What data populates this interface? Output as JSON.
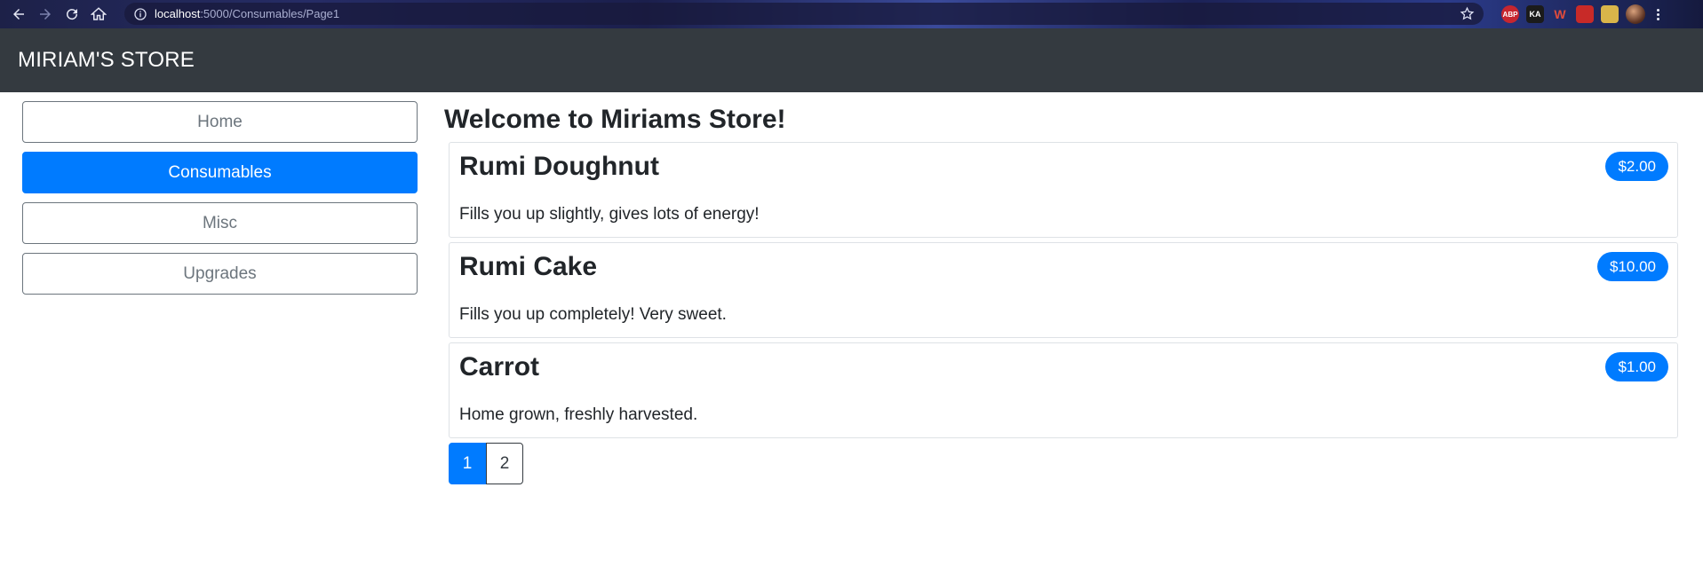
{
  "browser": {
    "url_host": "localhost",
    "url_path": ":5000/Consumables/Page1",
    "extensions": [
      "ABP",
      "KA",
      "W",
      "",
      ""
    ]
  },
  "site": {
    "brand": "MIRIAM'S STORE"
  },
  "sidebar": {
    "items": [
      {
        "label": "Home",
        "active": false
      },
      {
        "label": "Consumables",
        "active": true
      },
      {
        "label": "Misc",
        "active": false
      },
      {
        "label": "Upgrades",
        "active": false
      }
    ]
  },
  "main": {
    "heading": "Welcome to Miriams Store!",
    "products": [
      {
        "name": "Rumi Doughnut",
        "description": "Fills you up slightly, gives lots of energy!",
        "price": "$2.00"
      },
      {
        "name": "Rumi Cake",
        "description": "Fills you up completely! Very sweet.",
        "price": "$10.00"
      },
      {
        "name": "Carrot",
        "description": "Home grown, freshly harvested.",
        "price": "$1.00"
      }
    ],
    "pagination": {
      "pages": [
        "1",
        "2"
      ],
      "current": "1"
    }
  },
  "colors": {
    "accent": "#007bff",
    "navbar": "#343a40",
    "outline": "#6c757d"
  }
}
